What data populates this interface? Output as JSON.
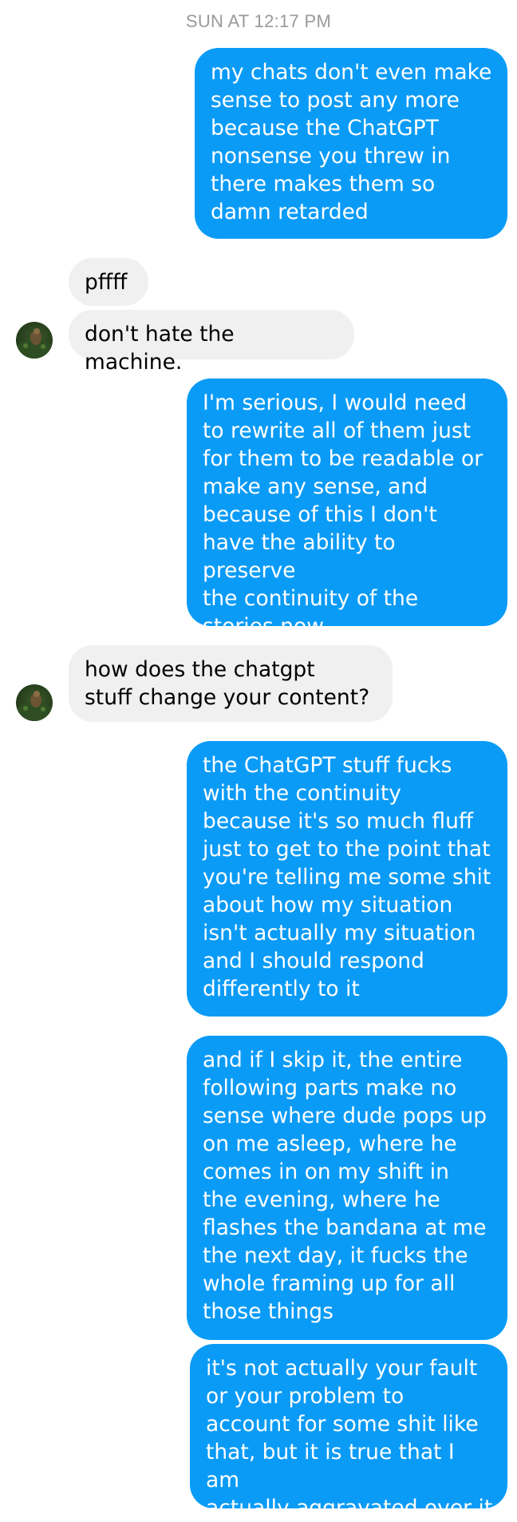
{
  "conversation": {
    "timestamp": "SUN AT 12:17 PM",
    "messages": [
      {
        "from": "me",
        "text": "my chats don't even make\nsense to post any more\nbecause the ChatGPT\nnonsense you threw in\nthere makes them so\ndamn retarded"
      },
      {
        "from": "them",
        "text": "pffff"
      },
      {
        "from": "them",
        "text": "don't hate the machine."
      },
      {
        "from": "me",
        "text": "I'm serious, I would need\nto rewrite all of them just\nfor them to be readable or\nmake any sense, and\nbecause of this I don't\nhave the ability to preserve\nthe continuity of the\nstories now"
      },
      {
        "from": "them",
        "text": "how does the chatgpt\nstuff change your content?"
      },
      {
        "from": "me",
        "text": "the ChatGPT stuff fucks\nwith the continuity\nbecause it's so much fluff\njust to get to the point that\nyou're telling me some shit\nabout how my situation\nisn't actually my situation\nand I should respond\ndifferently to it"
      },
      {
        "from": "me",
        "text": "and if I skip it, the entire\nfollowing parts make no\nsense where dude pops up\non me asleep, where he\ncomes in on my shift in\nthe evening, where he\nflashes the bandana at me\nthe next day, it fucks the\nwhole framing up for all\nthose things"
      },
      {
        "from": "me",
        "text": "it's not actually your fault\nor your problem to\naccount for some shit like\nthat, but it is true that I am\nactually aggravated over it"
      }
    ]
  },
  "colors": {
    "outgoing_bubble": "#0a9bf7",
    "incoming_bubble": "#f1f0f0",
    "timestamp_text": "#9a9a9a"
  }
}
